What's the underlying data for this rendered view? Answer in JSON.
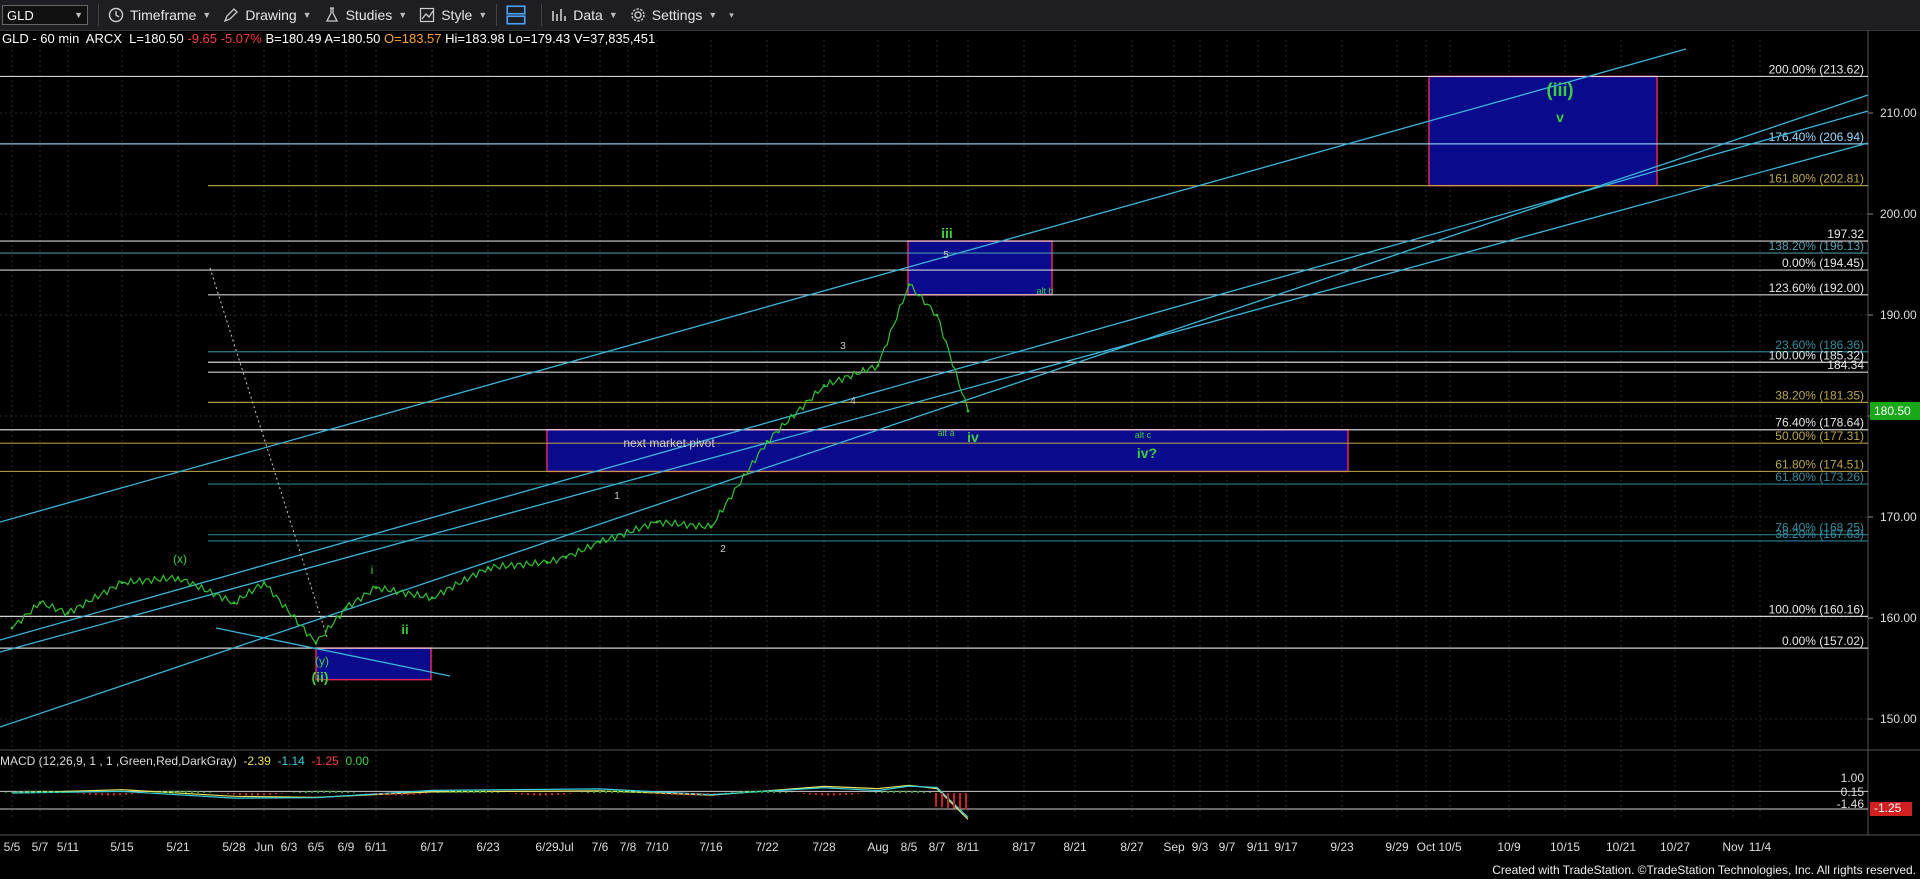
{
  "toolbar": {
    "symbol": "GLD",
    "timeframe": "Timeframe",
    "drawing": "Drawing",
    "studies": "Studies",
    "style": "Style",
    "data": "Data",
    "settings": "Settings"
  },
  "quote": {
    "header": "GLD - 60 min  ARCX  L=180.50",
    "change": "-9.65",
    "change_pct": "-5.07%",
    "bid": "B=180.49",
    "ask": "A=180.50",
    "open_label": "O=183.57",
    "hi": "Hi=183.98",
    "lo": "Lo=179.43",
    "vol": "V=37,835,451"
  },
  "macd": {
    "label": "MACD (12,26,9, 1 , 1 ,Green,Red,DarkGray)",
    "v1": "-2.39",
    "v2": "-1.14",
    "v3": "-1.25",
    "v4": "0.00"
  },
  "footer": "Created with TradeStation. ©TradeStation Technologies, Inc. All rights reserved.",
  "chart_data": {
    "type": "line",
    "price_axis": {
      "ticks": [
        "210.00",
        "200.00",
        "190.00",
        "180.00",
        "170.00",
        "160.00",
        "150.00"
      ],
      "last_price_tag": "180.50",
      "range": [
        145,
        217
      ]
    },
    "macd_axis": {
      "ticks": [
        "1.00",
        "0.15",
        "-1.46",
        "-1.25"
      ]
    },
    "x_ticks": [
      "5/5",
      "5/7",
      "5/11",
      "5/15",
      "5/21",
      "5/28",
      "Jun",
      "6/3",
      "6/5",
      "6/9",
      "6/11",
      "6/17",
      "6/23",
      "6/29",
      "Jul",
      "7/6",
      "7/8",
      "7/10",
      "7/16",
      "7/22",
      "7/28",
      "Aug",
      "8/5",
      "8/7",
      "8/11",
      "8/17",
      "8/21",
      "8/27",
      "Sep",
      "9/3",
      "9/7",
      "9/11",
      "9/17",
      "9/23",
      "9/29",
      "Oct",
      "10/5",
      "10/9",
      "10/15",
      "10/21",
      "10/27",
      "Nov",
      "11/4"
    ],
    "fib_levels": [
      {
        "label": "200.00% (213.62)",
        "value": 213.62,
        "color": "#e8e8e8"
      },
      {
        "label": "176.40% (206.94)",
        "value": 206.94,
        "color": "#9ad9ff"
      },
      {
        "label": "161.80% (202.81)",
        "value": 202.81,
        "color": "#bba644"
      },
      {
        "label": "197.32",
        "value": 197.32,
        "color": "#e8e8e8"
      },
      {
        "label": "138.20% (196.13)",
        "value": 196.13,
        "color": "#4fa0ad"
      },
      {
        "label": "0.00% (194.45)",
        "value": 194.45,
        "color": "#e8e8e8"
      },
      {
        "label": "123.60% (192.00)",
        "value": 192.0,
        "color": "#e8e8e8"
      },
      {
        "label": "23.60% (186.36)",
        "value": 186.36,
        "color": "#2f8fa0"
      },
      {
        "label": "100.00% (185.32)",
        "value": 185.32,
        "color": "#e8e8e8"
      },
      {
        "label": "184.34",
        "value": 184.34,
        "color": "#e8e8e8"
      },
      {
        "label": "38.20% (181.35)",
        "value": 181.35,
        "color": "#bba644"
      },
      {
        "label": "76.40% (178.64)",
        "value": 178.64,
        "color": "#e8e8e8"
      },
      {
        "label": "50.00% (177.31)",
        "value": 177.31,
        "color": "#bba644"
      },
      {
        "label": "61.80% (174.51)",
        "value": 174.51,
        "color": "#bba644"
      },
      {
        "label": "61.80% (173.26)",
        "value": 173.26,
        "color": "#2f8fa0"
      },
      {
        "label": "76.40% (168.25)",
        "value": 168.25,
        "color": "#2f8fa0"
      },
      {
        "label": "38.20% (167.63)",
        "value": 167.63,
        "color": "#2f8fa0"
      },
      {
        "label": "100.00% (160.16)",
        "value": 160.16,
        "color": "#e8e8e8"
      },
      {
        "label": "0.00% (157.02)",
        "value": 157.02,
        "color": "#e8e8e8"
      }
    ],
    "price_series": [
      {
        "x": "5/5",
        "y": 159
      },
      {
        "x": "5/7",
        "y": 161.5
      },
      {
        "x": "5/11",
        "y": 160.5
      },
      {
        "x": "5/15",
        "y": 163.5
      },
      {
        "x": "5/21",
        "y": 164
      },
      {
        "x": "5/28",
        "y": 161.5
      },
      {
        "x": "Jun",
        "y": 163.5
      },
      {
        "x": "6/5",
        "y": 157.5
      },
      {
        "x": "6/9",
        "y": 161
      },
      {
        "x": "6/11",
        "y": 163
      },
      {
        "x": "6/17",
        "y": 162
      },
      {
        "x": "6/23",
        "y": 165
      },
      {
        "x": "6/29",
        "y": 165.5
      },
      {
        "x": "Jul",
        "y": 166
      },
      {
        "x": "7/6",
        "y": 167.5
      },
      {
        "x": "7/10",
        "y": 169.5
      },
      {
        "x": "7/16",
        "y": 169
      },
      {
        "x": "7/22",
        "y": 177.5
      },
      {
        "x": "7/28",
        "y": 183
      },
      {
        "x": "Aug",
        "y": 185
      },
      {
        "x": "8/5",
        "y": 193
      },
      {
        "x": "8/7",
        "y": 190
      },
      {
        "x": "8/11",
        "y": 180.5
      }
    ],
    "macd_series": [
      {
        "x": "5/5",
        "y": 0.0
      },
      {
        "x": "5/15",
        "y": 0.3
      },
      {
        "x": "5/28",
        "y": -0.3
      },
      {
        "x": "6/5",
        "y": -0.4
      },
      {
        "x": "6/17",
        "y": 0.1
      },
      {
        "x": "7/6",
        "y": 0.2
      },
      {
        "x": "7/16",
        "y": -0.2
      },
      {
        "x": "7/28",
        "y": 0.6
      },
      {
        "x": "Aug",
        "y": 0.4
      },
      {
        "x": "8/5",
        "y": 0.7
      },
      {
        "x": "8/7",
        "y": 0.4
      },
      {
        "x": "8/11",
        "y": -2.39
      }
    ],
    "wave_labels": [
      {
        "text": "(iii)",
        "color": "#3bd13b"
      },
      {
        "text": "v",
        "color": "#3bd13b"
      },
      {
        "text": "iii",
        "color": "#3bd13b"
      },
      {
        "text": "5",
        "color": "#cccccc"
      },
      {
        "text": "alt b",
        "color": "#3bd13b"
      },
      {
        "text": "3",
        "color": "#cccccc"
      },
      {
        "text": "4",
        "color": "#cccccc"
      },
      {
        "text": "alt a",
        "color": "#3bd13b"
      },
      {
        "text": "iv",
        "color": "#3bd13b"
      },
      {
        "text": "alt c",
        "color": "#3bd13b"
      },
      {
        "text": "iv?",
        "color": "#3bd13b"
      },
      {
        "text": "next market pivot",
        "color": "#d0d0d0"
      },
      {
        "text": "1",
        "color": "#cccccc"
      },
      {
        "text": "2",
        "color": "#cccccc"
      },
      {
        "text": "(x)",
        "color": "#3bd13b"
      },
      {
        "text": "i",
        "color": "#3bd13b"
      },
      {
        "text": "ii",
        "color": "#3bd13b"
      },
      {
        "text": "(y)",
        "color": "#3bd13b"
      },
      {
        "text": "(ii)",
        "color": "#3bd13b"
      }
    ]
  }
}
